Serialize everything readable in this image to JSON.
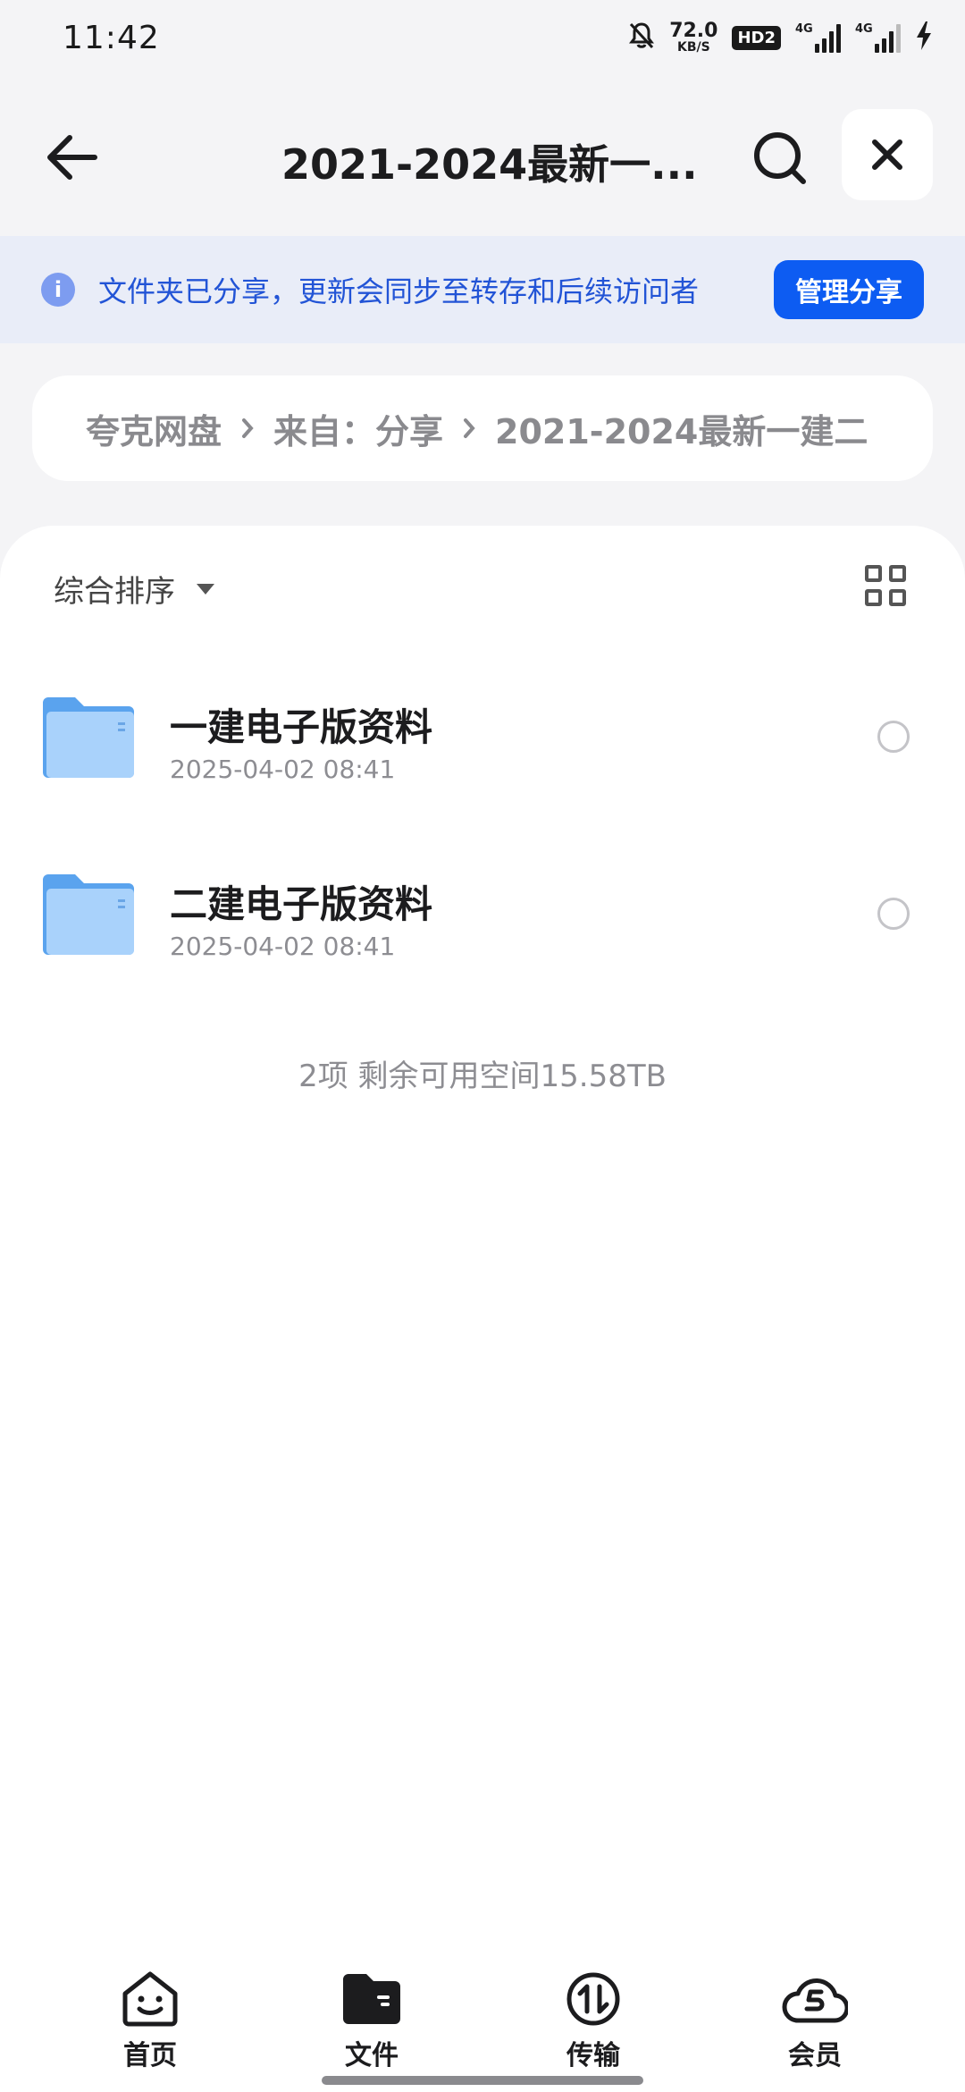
{
  "status": {
    "time": "11:42",
    "net_speed": "72.0",
    "net_unit": "KB/S",
    "hd_badge": "HD2",
    "signal_1_label": "4G",
    "signal_2_label": "4G"
  },
  "header": {
    "title": "2021-2024最新一...",
    "back_icon": "arrow-left-icon",
    "search_icon": "search-icon",
    "close_icon": "close-icon"
  },
  "share_banner": {
    "text": "文件夹已分享，更新会同步至转存和后续访问者",
    "button_label": "管理分享",
    "icon_glyph": "i"
  },
  "breadcrumb": {
    "items": [
      "夸克网盘",
      "来自：分享",
      "2021-2024最新一建二"
    ]
  },
  "sort": {
    "label": "综合排序"
  },
  "files": [
    {
      "name": "一建电子版资料",
      "date": "2025-04-02 08:41",
      "icon": "folder-icon"
    },
    {
      "name": "二建电子版资料",
      "date": "2025-04-02 08:41",
      "icon": "folder-icon"
    }
  ],
  "summary": "2项 剩余可用空间15.58TB",
  "nav": {
    "items": [
      {
        "label": "首页",
        "icon": "smile-icon"
      },
      {
        "label": "文件",
        "icon": "folder-icon"
      },
      {
        "label": "传输",
        "icon": "transfer-icon"
      },
      {
        "label": "会员",
        "icon": "member-cloud-icon"
      }
    ]
  },
  "colors": {
    "accent": "#0d5cf2",
    "banner_bg": "#e9edf8",
    "banner_text": "#2254d6",
    "folder": "#6aaef0"
  }
}
